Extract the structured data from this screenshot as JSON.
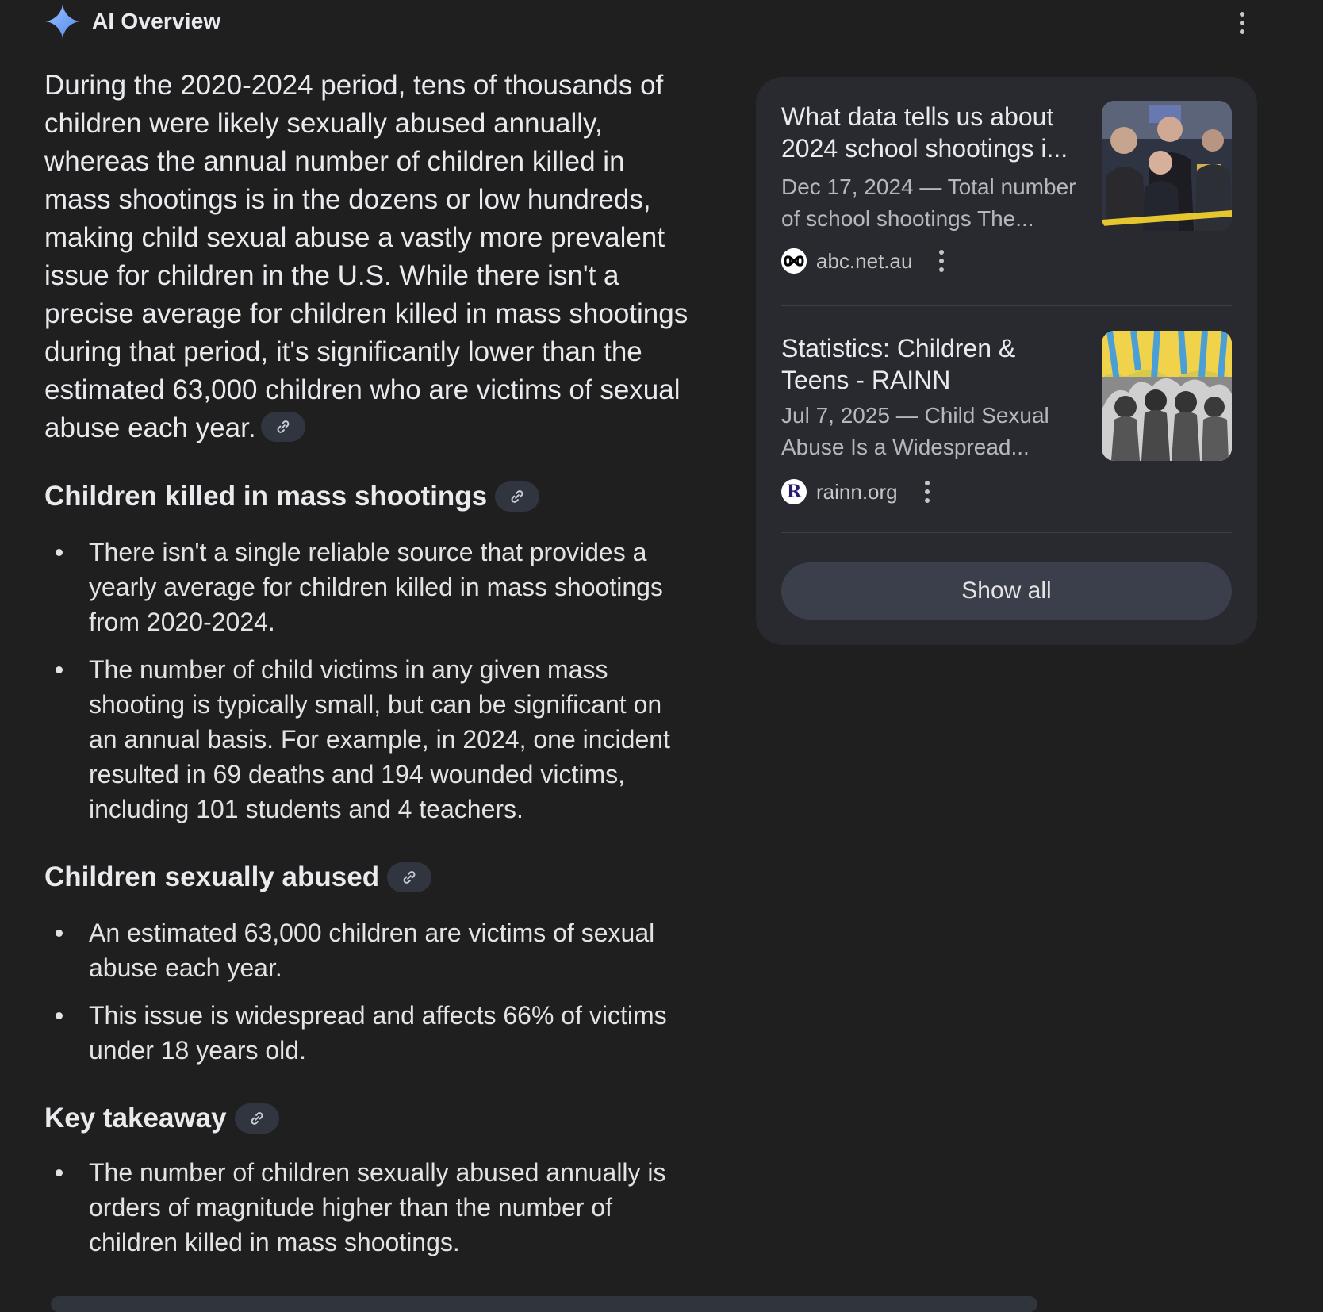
{
  "header": {
    "title": "AI Overview"
  },
  "main": {
    "lead": "During the 2020-2024 period, tens of thousands of children were likely sexually abused annually, whereas the annual number of children killed in mass shootings is in the dozens or low hundreds, making child sexual abuse a vastly more prevalent issue for children in the U.S. While there isn't a precise average for children killed in mass shootings during that period, it's significantly lower than the estimated 63,000 children who are victims of sexual abuse each year.",
    "sections": [
      {
        "title": "Children killed in mass shootings",
        "bullets": [
          "There isn't a single reliable source that provides a yearly average for children killed in mass shootings from 2020-2024.",
          "The number of child victims in any given mass shooting is typically small, but can be significant on an annual basis. For example, in 2024, one incident resulted in 69 deaths and 194 wounded victims, including 101 students and 4 teachers."
        ]
      },
      {
        "title": "Children sexually abused",
        "bullets": [
          "An estimated 63,000 children are victims of sexual abuse each year.",
          "This issue is widespread and affects 66% of victims under 18 years old."
        ]
      },
      {
        "title": "Key takeaway",
        "bullets": [
          "The number of children sexually abused annually is orders of magnitude higher than the number of children killed in mass shootings."
        ]
      }
    ]
  },
  "sources": {
    "items": [
      {
        "title": "What data tells us about 2024 school shootings i...",
        "snippet": "Dec 17, 2024 — Total number of school shootings The...",
        "site": "abc.net.au",
        "favicon": "abc-logo-icon"
      },
      {
        "title": "Statistics: Children & Teens - RAINN",
        "snippet": "Jul 7, 2025 — Child Sexual Abuse Is a Widespread...",
        "site": "rainn.org",
        "favicon": "rainn-logo-icon",
        "favicon_letter": "R"
      }
    ],
    "show_all": "Show all"
  },
  "colors": {
    "background": "#1f1f1f",
    "card": "#282a2f",
    "chip": "#30353f",
    "sparkle": "#8ab4f8"
  }
}
